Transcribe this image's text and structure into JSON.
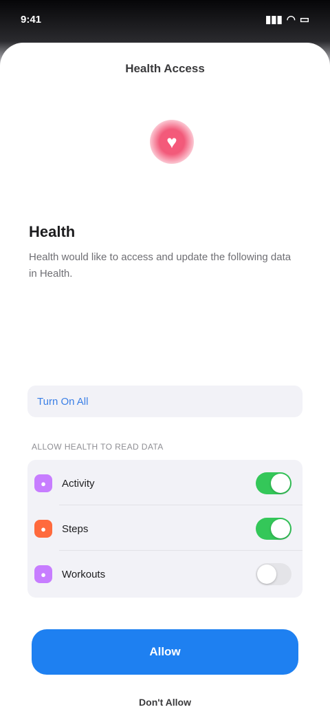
{
  "status_bar": {
    "time": "9:41",
    "signal": "▮▮▮",
    "wifi": "◠",
    "battery": "▭"
  },
  "sheet": {
    "header": "Health Access"
  },
  "health_icon": {
    "icon": "heart-icon",
    "glyph": "♥",
    "color": "#f25a7a"
  },
  "intro": {
    "app_name": "Health",
    "description": "Health would like to access and update the following data in Health."
  },
  "allow_all": {
    "label": "Turn On All"
  },
  "section_label": "Allow Health to read data",
  "permissions": [
    {
      "label": "Activity",
      "icon": "flame-icon",
      "glyph": "●",
      "color": "#c77dff",
      "enabled": true
    },
    {
      "label": "Steps",
      "icon": "steps-icon",
      "glyph": "●",
      "color": "#ff6a3d",
      "enabled": true
    },
    {
      "label": "Workouts",
      "icon": "workout-icon",
      "glyph": "●",
      "color": "#c77dff",
      "enabled": false
    }
  ],
  "primary_button": {
    "label": "Allow"
  },
  "secondary_link": {
    "label": "Don't Allow"
  },
  "colors": {
    "accent": "#1e80f1",
    "toggle_on": "#34c759",
    "link": "#3a7fe6"
  }
}
